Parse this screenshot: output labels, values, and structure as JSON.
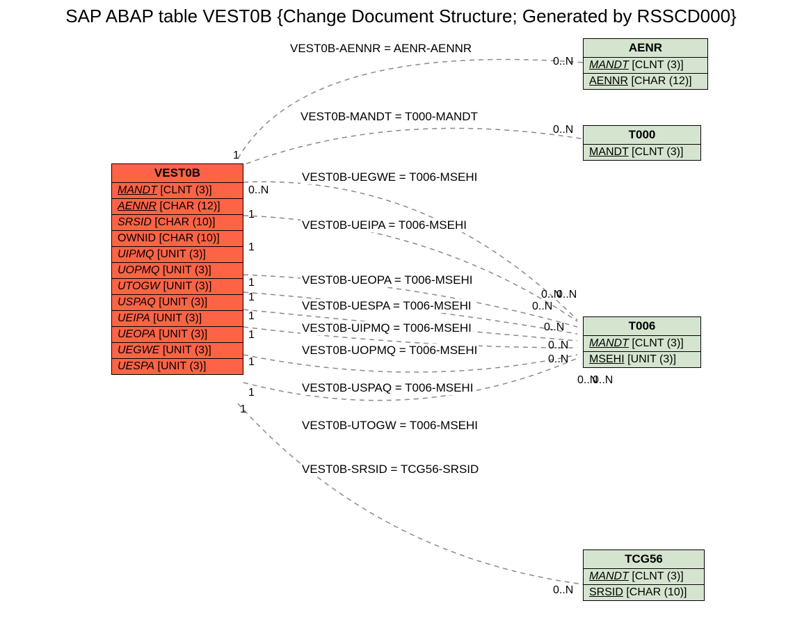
{
  "title": "SAP ABAP table VEST0B {Change Document Structure; Generated by RSSCD000}",
  "entities": {
    "vest0b": {
      "name": "VEST0B",
      "fields": [
        {
          "name": "MANDT",
          "type": "[CLNT (3)]",
          "italic": true,
          "key": true
        },
        {
          "name": "AENNR",
          "type": "[CHAR (12)]",
          "italic": true,
          "key": true
        },
        {
          "name": "SRSID",
          "type": "[CHAR (10)]",
          "italic": true,
          "key": false
        },
        {
          "name": "OWNID",
          "type": "[CHAR (10)]",
          "italic": false,
          "key": false
        },
        {
          "name": "UIPMQ",
          "type": "[UNIT (3)]",
          "italic": true,
          "key": false
        },
        {
          "name": "UOPMQ",
          "type": "[UNIT (3)]",
          "italic": true,
          "key": false
        },
        {
          "name": "UTOGW",
          "type": "[UNIT (3)]",
          "italic": true,
          "key": false
        },
        {
          "name": "USPAQ",
          "type": "[UNIT (3)]",
          "italic": true,
          "key": false
        },
        {
          "name": "UEIPA",
          "type": "[UNIT (3)]",
          "italic": true,
          "key": false
        },
        {
          "name": "UEOPA",
          "type": "[UNIT (3)]",
          "italic": true,
          "key": false
        },
        {
          "name": "UEGWE",
          "type": "[UNIT (3)]",
          "italic": true,
          "key": false
        },
        {
          "name": "UESPA",
          "type": "[UNIT (3)]",
          "italic": true,
          "key": false
        }
      ]
    },
    "aenr": {
      "name": "AENR",
      "fields": [
        {
          "name": "MANDT",
          "type": "[CLNT (3)]",
          "italic": true,
          "key": true
        },
        {
          "name": "AENNR",
          "type": "[CHAR (12)]",
          "italic": false,
          "key": true
        }
      ]
    },
    "t000": {
      "name": "T000",
      "fields": [
        {
          "name": "MANDT",
          "type": "[CLNT (3)]",
          "italic": false,
          "key": true
        }
      ]
    },
    "t006": {
      "name": "T006",
      "fields": [
        {
          "name": "MANDT",
          "type": "[CLNT (3)]",
          "italic": true,
          "key": true
        },
        {
          "name": "MSEHI",
          "type": "[UNIT (3)]",
          "italic": false,
          "key": true
        }
      ]
    },
    "tcg56": {
      "name": "TCG56",
      "fields": [
        {
          "name": "MANDT",
          "type": "[CLNT (3)]",
          "italic": true,
          "key": true
        },
        {
          "name": "SRSID",
          "type": "[CHAR (10)]",
          "italic": false,
          "key": true
        }
      ]
    }
  },
  "relations": [
    {
      "label": "VEST0B-AENNR = AENR-AENNR"
    },
    {
      "label": "VEST0B-MANDT = T000-MANDT"
    },
    {
      "label": "VEST0B-UEGWE = T006-MSEHI"
    },
    {
      "label": "VEST0B-UEIPA = T006-MSEHI"
    },
    {
      "label": "VEST0B-UEOPA = T006-MSEHI"
    },
    {
      "label": "VEST0B-UESPA = T006-MSEHI"
    },
    {
      "label": "VEST0B-UIPMQ = T006-MSEHI"
    },
    {
      "label": "VEST0B-UOPMQ = T006-MSEHI"
    },
    {
      "label": "VEST0B-USPAQ = T006-MSEHI"
    },
    {
      "label": "VEST0B-UTOGW = T006-MSEHI"
    },
    {
      "label": "VEST0B-SRSID = TCG56-SRSID"
    }
  ],
  "cards": {
    "one": "1",
    "many": "0..N"
  }
}
